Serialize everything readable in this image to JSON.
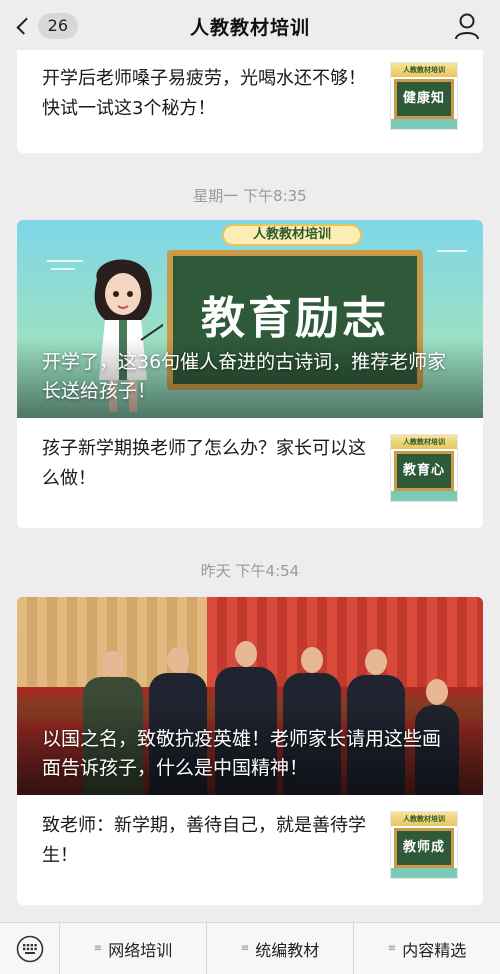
{
  "header": {
    "unread_count": "26",
    "title": "人教教材培训"
  },
  "articles": {
    "top_item": {
      "title": "开学后老师嗓子易疲劳，光喝水还不够！快试一试这3个秘方！",
      "thumb_label": "健康知识"
    },
    "group1": {
      "time": "星期一 下午8:35",
      "hero_badge": "人教教材培训",
      "hero_board": "教育励志",
      "hero_title": "开学了，这36句催人奋进的古诗词，推荐老师家长送给孩子！",
      "sub_item": {
        "title": "孩子新学期换老师了怎么办？家长可以这么做！",
        "thumb_label": "教育心得"
      }
    },
    "group2": {
      "time": "昨天 下午4:54",
      "hero_title": "以国之名，致敬抗疫英雄！老师家长请用这些画面告诉孩子，什么是中国精神！",
      "sub_item": {
        "title": "致老师：新学期，善待自己，就是善待学生！",
        "thumb_label": "教师成长"
      }
    },
    "thumb_header": "人教教材培训"
  },
  "bottom_menu": {
    "items": [
      "网络培训",
      "统编教材",
      "内容精选"
    ]
  },
  "colors": {
    "board_green": "#2f5a3a",
    "frame_gold": "#c99a4a",
    "background": "#ededed"
  }
}
